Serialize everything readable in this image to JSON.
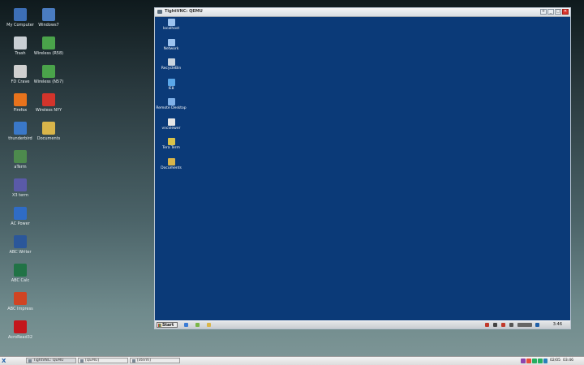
{
  "desktop": {
    "icons": [
      {
        "label": "My Computer",
        "icon": "monitor-icon",
        "color": "#3d6fb6"
      },
      {
        "label": "Windows7",
        "icon": "monitor-icon",
        "color": "#4a7cc0"
      },
      {
        "label": "Trash",
        "icon": "trash-icon",
        "color": "#c9cfd4"
      },
      {
        "label": "Wireless (R58)",
        "icon": "wireless-icon",
        "color": "#4aa34a"
      },
      {
        "label": "FD Crave",
        "icon": "drive-icon",
        "color": "#d0d0d0"
      },
      {
        "label": "Wireless (N57)",
        "icon": "wireless-icon",
        "color": "#4aa34a"
      },
      {
        "label": "Firefox",
        "icon": "firefox-icon",
        "color": "#e8731c"
      },
      {
        "label": "Wireless NYY",
        "icon": "wireless-error-icon",
        "color": "#d3342b"
      },
      {
        "label": "thunderbird",
        "icon": "thunderbird-icon",
        "color": "#3a78c8"
      },
      {
        "label": "Documents",
        "icon": "folder-icon",
        "color": "#d9b54a"
      },
      {
        "label": "aTerm",
        "icon": "terminal-icon",
        "color": "#4d8a4d"
      },
      {
        "label": "X3 term",
        "icon": "terminal-icon",
        "color": "#5a5aa8"
      },
      {
        "label": "AC Power",
        "icon": "power-icon",
        "color": "#2f6cc6"
      },
      {
        "label": "ABC Writer",
        "icon": "writer-icon",
        "color": "#2b579a"
      },
      {
        "label": "ABC Calc",
        "icon": "calc-icon",
        "color": "#217346"
      },
      {
        "label": "ABC Impress",
        "icon": "impress-icon",
        "color": "#d04423"
      },
      {
        "label": "AcroRead32",
        "icon": "pdf-icon",
        "color": "#c4161c"
      }
    ]
  },
  "vnc_window": {
    "title": "TightVNC: QEMU",
    "buttons": [
      "+",
      "_",
      "□",
      "✕"
    ],
    "remote_icons": [
      {
        "label": "localhost",
        "icon": "computer-icon",
        "color": "#9cc3f0"
      },
      {
        "label": "Network",
        "icon": "network-icon",
        "color": "#9cc3f0"
      },
      {
        "label": "RecycleBin",
        "icon": "recycle-bin-icon",
        "color": "#c9d4df"
      },
      {
        "label": "IE8",
        "icon": "ie-icon",
        "color": "#5aa6e8"
      },
      {
        "label": "Remote Desktop",
        "icon": "remote-desktop-icon",
        "color": "#7fb0e8"
      },
      {
        "label": "vncviewer",
        "icon": "vnc-icon",
        "color": "#e6e6e6"
      },
      {
        "label": "Tera Term",
        "icon": "teraterm-icon",
        "color": "#d8c24a"
      },
      {
        "label": "Documents",
        "icon": "folder-icon",
        "color": "#d9b54a"
      }
    ],
    "taskbar": {
      "start_label": "Start",
      "quick_icons": [
        "#3a7bd5",
        "#7ab648",
        "#d9b54a"
      ],
      "tray_icons": [
        "#c0392b",
        "#444444",
        "#c0392b",
        "#555555",
        "#666666",
        "#1f5fa8"
      ],
      "clock": "3:46"
    }
  },
  "host_taskbar": {
    "launcher": "X",
    "tasks": [
      {
        "label": "TightVNC: QEMU",
        "active": true
      },
      {
        "label": "[QEMU]",
        "active": false
      },
      {
        "label": "[xterm]",
        "active": false
      }
    ],
    "tray_icons": [
      "#8e44ad",
      "#e74c3c",
      "#27ae60",
      "#27ae60",
      "#2980b9",
      "#555555"
    ],
    "date": "02/05",
    "time": "03:46"
  }
}
